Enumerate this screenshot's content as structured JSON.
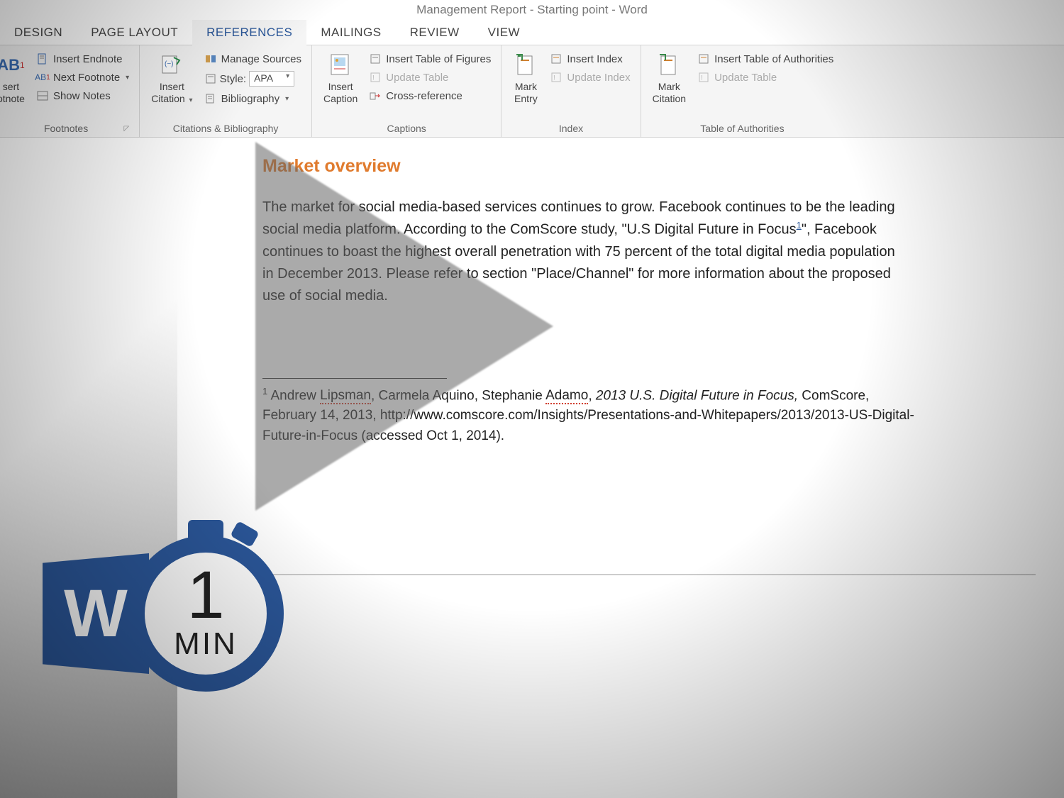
{
  "window": {
    "title": "Management Report - Starting point - Word"
  },
  "tabs": {
    "design": "DESIGN",
    "page_layout": "PAGE LAYOUT",
    "references": "REFERENCES",
    "mailings": "MAILINGS",
    "review": "REVIEW",
    "view": "VIEW"
  },
  "ribbon": {
    "footnotes": {
      "label": "Footnotes",
      "insert_footnote_big_top": "AB",
      "insert_footnote_big_bottom1": "sert",
      "insert_footnote_big_bottom2": "otnote",
      "insert_endnote": "Insert Endnote",
      "next_footnote": "Next Footnote",
      "show_notes": "Show Notes"
    },
    "citations": {
      "label": "Citations & Bibliography",
      "insert_citation_top": "Insert",
      "insert_citation_bottom": "Citation",
      "manage_sources": "Manage Sources",
      "style_label": "Style:",
      "style_value": "APA",
      "bibliography": "Bibliography"
    },
    "captions": {
      "label": "Captions",
      "insert_caption_top": "Insert",
      "insert_caption_bottom": "Caption",
      "insert_table_figures": "Insert Table of Figures",
      "update_table": "Update Table",
      "cross_reference": "Cross-reference"
    },
    "index": {
      "label": "Index",
      "mark_entry_top": "Mark",
      "mark_entry_bottom": "Entry",
      "insert_index": "Insert Index",
      "update_index": "Update Index"
    },
    "authorities": {
      "label": "Table of Authorities",
      "mark_citation_top": "Mark",
      "mark_citation_bottom": "Citation",
      "insert_table_authorities": "Insert Table of Authorities",
      "update_table": "Update Table"
    }
  },
  "document": {
    "heading": "Market overview",
    "body": "The market for social media-based services continues to grow. Facebook continues to be the leading social media platform.  According to the ComScore study, \"U.S Digital Future in Focus",
    "body_after_ref": "\", Facebook continues to boast the highest overall penetration with 75 percent of the total digital media population in December 2013. Please refer to section \"Place/Channel\" for more information about the proposed use of social media.",
    "footnote_ref": "1",
    "footnote_num": "1",
    "footnote_text_1": " Andrew ",
    "footnote_name1": "Lipsman",
    "footnote_text_2": ", Carmela Aquino, Stephanie ",
    "footnote_name2": "Adamo",
    "footnote_text_3": ", ",
    "footnote_italic": "2013 U.S. Digital Future in Focus,",
    "footnote_text_4": " ComScore, February 14, 2013, http://www.comscore.com/Insights/Presentations-and-Whitepapers/2013/2013-US-Digital-Future-in-Focus (accessed Oct 1, 2014)."
  },
  "badge": {
    "word_letter": "W",
    "timer_num": "1",
    "timer_unit": "MIN"
  }
}
